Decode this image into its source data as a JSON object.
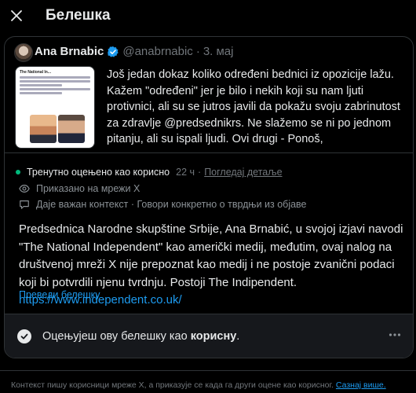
{
  "header": {
    "title": "Белешка",
    "close_icon": "close-icon"
  },
  "tweet": {
    "author_name": "Ana Brnabic",
    "handle": "@anabrnabic",
    "separator": "·",
    "date": "3. мај",
    "text": "Još jedan dokaz koliko određeni bednici iz opozicije lažu. Kažem \"određeni\" jer je bilo i nekih koji su nam ljuti protivnici, ali su se jutros javili da pokažu svoju zabrinutost za zdravlje @predsednikrs. Ne slažemo se ni po jednom pitanju, ali su ispali ljudi. Ovi drugi - Ponoš,",
    "media_header": "The National In...",
    "verified_color": "#1d9bf0"
  },
  "note": {
    "status_text": "Тренутно оцењено као корисно",
    "status_time": "22 ч",
    "status_separator": "·",
    "status_link": "Погледај детаље",
    "shown_on": "Приказано на мрежи X",
    "context": "Даје важан контекст · Говори конкретно о тврдњи из објаве",
    "text": "Predsednica Narodne skupštine Srbije, Ana Brnabić, u svojoj izjavi navodi \"The National Independent\" kao američki medij, međutim, ovaj nalog na društvenoj mreži X nije prepoznat kao medij i ne postoje zvanični podaci koji bi potvrdili njenu tvrdnju. Postoji The Indipendent.",
    "link": "https://www.independent.co.uk/",
    "translate": "Преведи белешку",
    "status_color": "#00ba7c"
  },
  "rating": {
    "prefix": "Оцењујеш ову белешку као ",
    "value": "корисну",
    "suffix": "."
  },
  "footer": {
    "text": "Контекст пишу корисници мреже X, а приказује се када га други оцене као корисног. ",
    "link": "Сазнај више."
  }
}
